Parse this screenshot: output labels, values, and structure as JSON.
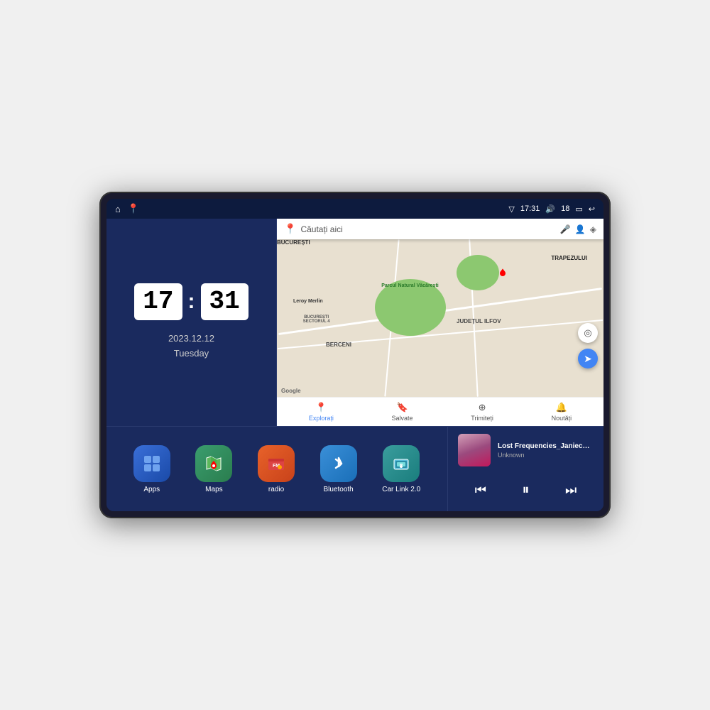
{
  "device": {
    "title": "Car Android Head Unit"
  },
  "status_bar": {
    "signal_icon": "▽",
    "time": "17:31",
    "volume_icon": "🔊",
    "battery_level": "18",
    "battery_icon": "🔋",
    "back_icon": "↩",
    "home_icon": "⌂",
    "maps_shortcut_icon": "📍"
  },
  "clock": {
    "hours": "17",
    "minutes": "31",
    "date": "2023.12.12",
    "day": "Tuesday"
  },
  "map": {
    "search_placeholder": "Căutați aici",
    "google_logo": "Google",
    "bottom_nav": [
      {
        "label": "Explorați",
        "icon": "📍",
        "active": true
      },
      {
        "label": "Salvate",
        "icon": "🔖",
        "active": false
      },
      {
        "label": "Trimiteți",
        "icon": "⊕",
        "active": false
      },
      {
        "label": "Noutăți",
        "icon": "🔔",
        "active": false
      }
    ],
    "labels": {
      "bucuresti": "BUCUREȘTI",
      "judet_ilfov": "JUDEȚUL ILFOV",
      "berceni": "BERCENI",
      "trapezului": "TRAPEZULUI",
      "leroy_merlin": "Leroy Merlin",
      "parcul": "Parcul Natural Văcărești",
      "bucuresti_s4": "BUCUREȘTI\nSECTORUL 4"
    }
  },
  "apps": [
    {
      "id": "apps",
      "label": "Apps",
      "icon": "⊞",
      "color_class": "icon-apps"
    },
    {
      "id": "maps",
      "label": "Maps",
      "icon": "🗺",
      "color_class": "icon-maps"
    },
    {
      "id": "radio",
      "label": "radio",
      "icon": "📻",
      "color_class": "icon-radio"
    },
    {
      "id": "bluetooth",
      "label": "Bluetooth",
      "icon": "⚡",
      "color_class": "icon-bluetooth"
    },
    {
      "id": "carlink",
      "label": "Car Link 2.0",
      "icon": "🔗",
      "color_class": "icon-carlink"
    }
  ],
  "music": {
    "title": "Lost Frequencies_Janieck Devy-...",
    "artist": "Unknown",
    "controls": {
      "prev": "⏮",
      "play": "⏸",
      "next": "⏭"
    }
  }
}
